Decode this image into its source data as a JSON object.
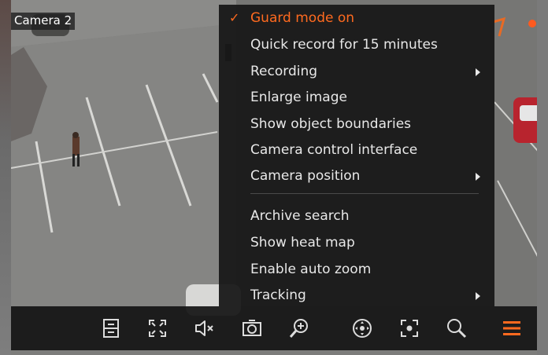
{
  "camera": {
    "name": "Camera 2"
  },
  "context_menu": {
    "items": [
      {
        "label": "Guard mode on",
        "checked": true,
        "submenu": false
      },
      {
        "label": "Quick record for 15 minutes",
        "checked": false,
        "submenu": false
      },
      {
        "label": "Recording",
        "checked": false,
        "submenu": true
      },
      {
        "label": "Enlarge image",
        "checked": false,
        "submenu": false
      },
      {
        "label": "Show object boundaries",
        "checked": false,
        "submenu": false
      },
      {
        "label": "Camera control interface",
        "checked": false,
        "submenu": false
      },
      {
        "label": "Camera position",
        "checked": false,
        "submenu": true
      },
      {
        "label": "Archive search",
        "checked": false,
        "submenu": false
      },
      {
        "label": "Show heat map",
        "checked": false,
        "submenu": false
      },
      {
        "label": "Enable auto zoom",
        "checked": false,
        "submenu": false
      },
      {
        "label": "Tracking",
        "checked": false,
        "submenu": true
      }
    ],
    "check_glyph": "✓"
  },
  "toolbar": {
    "icons": [
      "info-panel-icon",
      "fullscreen-icon",
      "mute-icon",
      "snapshot-icon",
      "zoom-in-icon",
      "ptz-control-icon",
      "focus-object-icon",
      "search-icon",
      "menu-icon"
    ]
  },
  "colors": {
    "accent": "#ff6a1f",
    "menu_bg": "#171717",
    "menu_text": "#e8e8e8",
    "toolbar_icon": "#dcdcdc"
  }
}
